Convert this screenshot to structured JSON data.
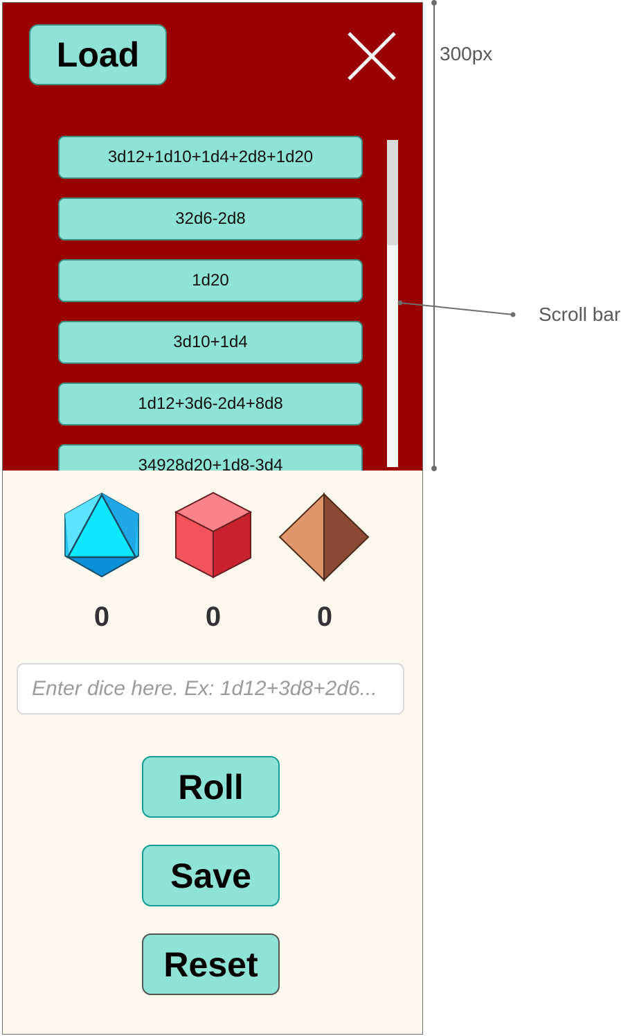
{
  "header": {
    "load_label": "Load"
  },
  "saved_rolls": [
    "3d12+1d10+1d4+2d8+1d20",
    "32d6-2d8",
    "1d20",
    "3d10+1d4",
    "1d12+3d6-2d4+8d8",
    "34928d20+1d8-3d4"
  ],
  "dice": [
    {
      "icon": "d20-icon",
      "value": "0",
      "color": "#0de8ff"
    },
    {
      "icon": "d6-icon",
      "value": "0",
      "color": "#f0535c"
    },
    {
      "icon": "d4-icon",
      "value": "0",
      "color": "#e0956a"
    }
  ],
  "input": {
    "placeholder": "Enter dice here. Ex: 1d12+3d8+2d6..."
  },
  "actions": {
    "roll_label": "Roll",
    "save_label": "Save",
    "reset_label": "Reset"
  },
  "annotations": {
    "height_label": "300px",
    "scrollbar_label": "Scroll bar"
  },
  "colors": {
    "panel": "#990000",
    "button": "#8fe3d6",
    "background": "#fdf8ee"
  }
}
